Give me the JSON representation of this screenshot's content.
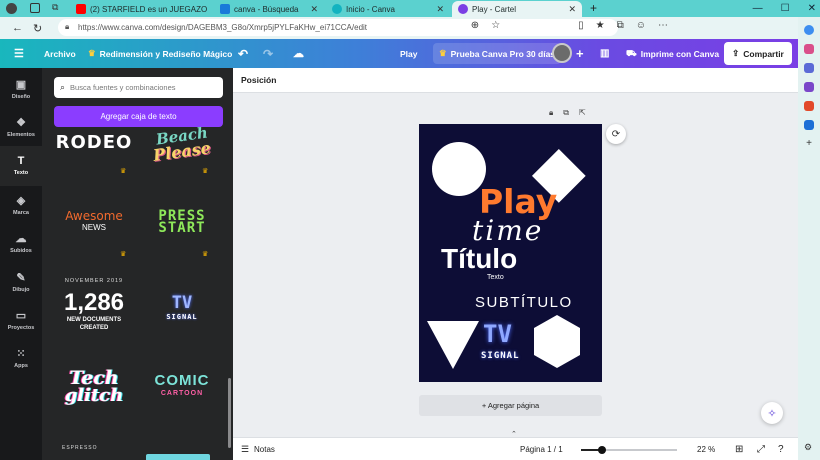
{
  "browser": {
    "tabs": [
      {
        "label": "(2) STARFIELD es un JUEGAZO",
        "color": "#ff0000"
      },
      {
        "label": "canva - Búsqueda",
        "color": "#1a7ad9"
      },
      {
        "label": "Inicio - Canva",
        "color": "#13b3c0"
      },
      {
        "label": "Play - Cartel",
        "color": "#7b3fe4"
      }
    ],
    "url": "https://www.canva.com/design/DAGEBM3_G8o/Xmrp5jPYLFaKHw_ei71CCA/edit",
    "controls": [
      "—",
      "☐",
      "✕"
    ]
  },
  "header": {
    "file_label": "Archivo",
    "magic_label": "Redimensión y Rediseño Mágico",
    "play_label": "Play",
    "trial_label": "Prueba Canva Pro 30 días",
    "add_label": "+",
    "print_label": "Imprime con Canva",
    "share_label": "Compartir"
  },
  "rail": {
    "items": [
      {
        "label": "Diseño",
        "icon": "layout-icon",
        "glyph": "▣"
      },
      {
        "label": "Elementos",
        "icon": "shapes-icon",
        "glyph": "❖"
      },
      {
        "label": "Texto",
        "icon": "text-icon",
        "glyph": "T"
      },
      {
        "label": "Marca",
        "icon": "brand-icon",
        "glyph": "◈"
      },
      {
        "label": "Subidos",
        "icon": "upload-icon",
        "glyph": "☁"
      },
      {
        "label": "Dibujo",
        "icon": "draw-icon",
        "glyph": "✎"
      },
      {
        "label": "Proyectos",
        "icon": "folder-icon",
        "glyph": "▭"
      },
      {
        "label": "Apps",
        "icon": "apps-icon",
        "glyph": "⁙"
      }
    ]
  },
  "panel": {
    "search_placeholder": "Busca fuentes y combinaciones",
    "add_text_label": "Agregar caja de texto",
    "tiles": {
      "rodeo": "RODEO",
      "beach_1": "Beach",
      "beach_2": "Please",
      "awesome": "Awesome",
      "news": "NEWS",
      "press": "PRESS",
      "start": "START",
      "nov": "NOVEMBER 2019",
      "count": "1,286",
      "docs_1": "NEW DOCUMENTS",
      "docs_2": "CREATED",
      "tv_1": "TV",
      "tv_2": "SIGNAL",
      "tech_1": "Tech",
      "tech_2": "glitch",
      "comic_1": "COMIC",
      "comic_2": "CARTOON",
      "espresso": "ESPRESSO"
    }
  },
  "editor": {
    "toolbar_label": "Posición",
    "add_page_label": "+ Agregar página",
    "notes_label": "Notas",
    "page_indicator": "Página 1 / 1",
    "zoom_label": "22 %",
    "zoom_level": 22
  },
  "design": {
    "play": "Play",
    "time": "time",
    "titulo": "Título",
    "texto": "Texto",
    "subtitulo": "SUBTÍTULO",
    "tv_1": "TV",
    "tv_2": "SIGNAL"
  },
  "colors": {
    "accent_purple": "#8b3dff",
    "poster_bg": "#0d0d36",
    "play_orange": "#ff7a2e"
  }
}
